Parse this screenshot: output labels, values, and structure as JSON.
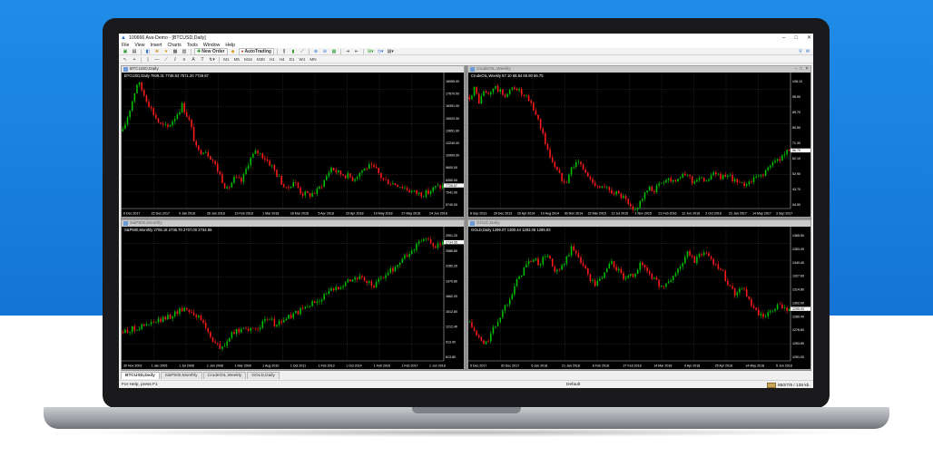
{
  "app": {
    "window_title": "100666 Ava-Demo - [BTCUSD,Daily]",
    "menu": [
      "File",
      "View",
      "Insert",
      "Charts",
      "Tools",
      "Window",
      "Help"
    ]
  },
  "toolbar": {
    "new_order_label": "New Order",
    "autotrading_label": "AutoTrading",
    "timeframes": [
      "M1",
      "M5",
      "M15",
      "M30",
      "H1",
      "H4",
      "D1",
      "W1",
      "MN"
    ]
  },
  "charts": [
    {
      "window_title": "BTCUSD,Daily",
      "info": "BTCUSD,Daily  7609.31 7748.53 7571.20 7726.67",
      "active": true,
      "price_labels": [
        "18955.00",
        "17670.00",
        "16391.00",
        "15020.00",
        "13651.00",
        "12240.00",
        "10900.00",
        "9600.00",
        "8350.00",
        "7041.00",
        "5740.00"
      ],
      "date_labels": [
        "6 Dec 2017",
        "22 Dec 2017",
        "9 Jan 2018",
        "26 Jan 2018",
        "13 Feb 2018",
        "1 Mar 2018",
        "18 Mar 2018",
        "5 Apr 2018",
        "23 Apr 2018",
        "10 May 2018",
        "27 May 2018",
        "14 Jun 2018"
      ],
      "current_price": "7726.67"
    },
    {
      "window_title": "CrudeOIL,Weekly",
      "info": "CrudeOIL,Weekly  67.10 68.84 65.80 66.75",
      "active": false,
      "price_labels": [
        "108.10",
        "98.90",
        "89.70",
        "80.50",
        "71.30",
        "62.10",
        "52.90",
        "43.70",
        "34.50"
      ],
      "date_labels": [
        "8 Sep 2013",
        "29 Dec 2013",
        "20 Apr 2014",
        "10 Aug 2014",
        "30 Nov 2014",
        "22 Mar 2015",
        "12 Jul 2015",
        "1 Nov 2015",
        "21 Feb 2016",
        "12 Jun 2016",
        "2 Oct 2016",
        "22 Jan 2017",
        "14 May 2017",
        "3 Sep 2017"
      ],
      "current_price": "66.75"
    },
    {
      "window_title": "S&P500,Monthly",
      "info": "S&P500,Monthly  2708.16 2736.70 2707.00 2734.55",
      "active": false,
      "price_labels": [
        "2901.20",
        "2586.80",
        "2282.20",
        "1970.80",
        "1662.20",
        "1512.80",
        "1212.40",
        "913.00",
        "613.80"
      ],
      "date_labels": [
        "30 Nov 2003",
        "1 Jan 2005",
        "1 Jul 2006",
        "1 Jan 2008",
        "1 Mar 2009",
        "1 Aug 2010",
        "1 Oct 2011",
        "1 Feb 2013",
        "1 Oct 2014",
        "1 Feb 2016",
        "1 Feb 2017",
        "1 Jun 2018"
      ],
      "current_price": "2734.55"
    },
    {
      "window_title": "GOLD,Daily",
      "info": "GOLD,Daily  1299.07 1300.44 1293.06 1295.93",
      "active": false,
      "price_labels": [
        "1365.50",
        "1353.00",
        "1340.40",
        "1327.60",
        "1314.80",
        "1302.00",
        "1289.40",
        "1276.60",
        "1263.80",
        "1251.00"
      ],
      "date_labels": [
        "5 Dec 2017",
        "20 Dec 2017",
        "6 Jan 2018",
        "21 Jan 2018",
        "8 Feb 2018",
        "27 Feb 2018",
        "14 Mar 2018",
        "9 Apr 2018",
        "25 Apr 2018",
        "14 May 2018",
        "5 Jun 2018"
      ],
      "current_price": "1295.93"
    }
  ],
  "tabs": [
    "BTCUSD,Daily",
    "S&P500,Monthly",
    "CrudeOIL,Weekly",
    "GOLD,Daily"
  ],
  "status": {
    "help": "For Help, press F1",
    "profile": "Default",
    "traffic": "850/7/9 / 139 kb"
  },
  "colors": {
    "bull_candle": "#00c000",
    "bear_candle": "#ff1a1a",
    "chart_bg": "#000000",
    "gradient_blue": "#1474d6"
  },
  "chart_data": [
    {
      "type": "line",
      "title": "BTCUSD,Daily",
      "x_range": [
        "6 Dec 2017",
        "14 Jun 2018"
      ],
      "ylim": [
        5740,
        18955
      ],
      "values": [
        13500,
        16000,
        18800,
        17200,
        15600,
        14200,
        13900,
        15000,
        16300,
        14500,
        11300,
        11600,
        10600,
        9000,
        7300,
        8500,
        8200,
        10500,
        11400,
        10800,
        9900,
        8600,
        7300,
        8300,
        7000,
        6800,
        7100,
        8200,
        9700,
        9100,
        8900,
        8500,
        9300,
        9800,
        9500,
        8400,
        8100,
        7900,
        7500,
        7100,
        6900,
        7000,
        7600,
        7700
      ]
    },
    {
      "type": "line",
      "title": "CrudeOIL,Weekly",
      "x_range": [
        "8 Sep 2013",
        "3 Sep 2017"
      ],
      "ylim": [
        34.5,
        108.1
      ],
      "values": [
        98,
        103,
        95,
        101,
        99,
        104,
        102,
        99,
        100,
        104,
        103,
        98,
        97,
        92,
        86,
        78,
        67,
        61,
        55,
        50,
        49,
        56,
        60,
        58,
        53,
        49,
        47,
        45,
        44,
        43,
        42,
        40,
        38,
        33,
        30,
        36,
        40,
        44,
        43,
        46,
        49,
        50,
        49,
        51,
        51,
        53,
        48,
        50,
        49,
        50,
        52,
        53,
        51,
        50,
        51,
        48,
        46,
        47,
        49,
        50,
        52,
        54,
        57,
        60,
        62,
        65,
        66
      ]
    },
    {
      "type": "line",
      "title": "S&P500,Monthly",
      "x_range": [
        "30 Nov 2003",
        "1 Jun 2018"
      ],
      "ylim": [
        613.8,
        2901.2
      ],
      "values": [
        1080,
        1120,
        1150,
        1180,
        1210,
        1250,
        1290,
        1340,
        1400,
        1470,
        1530,
        1480,
        1380,
        1270,
        1050,
        880,
        750,
        930,
        1060,
        1120,
        1190,
        1080,
        1180,
        1260,
        1320,
        1200,
        1300,
        1360,
        1420,
        1480,
        1550,
        1620,
        1700,
        1780,
        1850,
        1920,
        2000,
        2060,
        2100,
        2050,
        1980,
        1930,
        2090,
        2170,
        2260,
        2380,
        2480,
        2590,
        2720,
        2850,
        2700,
        2660,
        2730
      ]
    },
    {
      "type": "line",
      "title": "GOLD,Daily",
      "x_range": [
        "5 Dec 2017",
        "5 Jun 2018"
      ],
      "ylim": [
        1251,
        1365.5
      ],
      "values": [
        1283,
        1270,
        1262,
        1276,
        1290,
        1305,
        1320,
        1334,
        1342,
        1338,
        1347,
        1328,
        1335,
        1352,
        1345,
        1330,
        1318,
        1325,
        1340,
        1332,
        1322,
        1328,
        1338,
        1330,
        1320,
        1316,
        1325,
        1335,
        1348,
        1340,
        1350,
        1342,
        1335,
        1322,
        1310,
        1318,
        1300,
        1290,
        1288,
        1296,
        1299,
        1295
      ]
    }
  ]
}
